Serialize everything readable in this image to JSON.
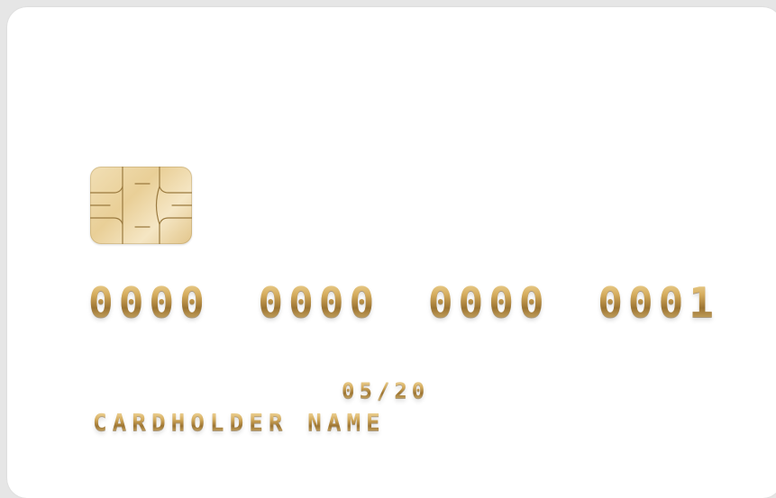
{
  "card": {
    "number_groups": [
      "0000",
      "0000",
      "0000",
      "0001"
    ],
    "expiry": "05/20",
    "cardholder_name": "CARDHOLDER NAME"
  },
  "colors": {
    "card_background": "#ffffff",
    "page_background": "#e6e6e6",
    "embossed_gold": "#c9a35a",
    "chip_gold": "#e9cf97"
  },
  "icons": {
    "chip": "emv-chip-icon"
  }
}
